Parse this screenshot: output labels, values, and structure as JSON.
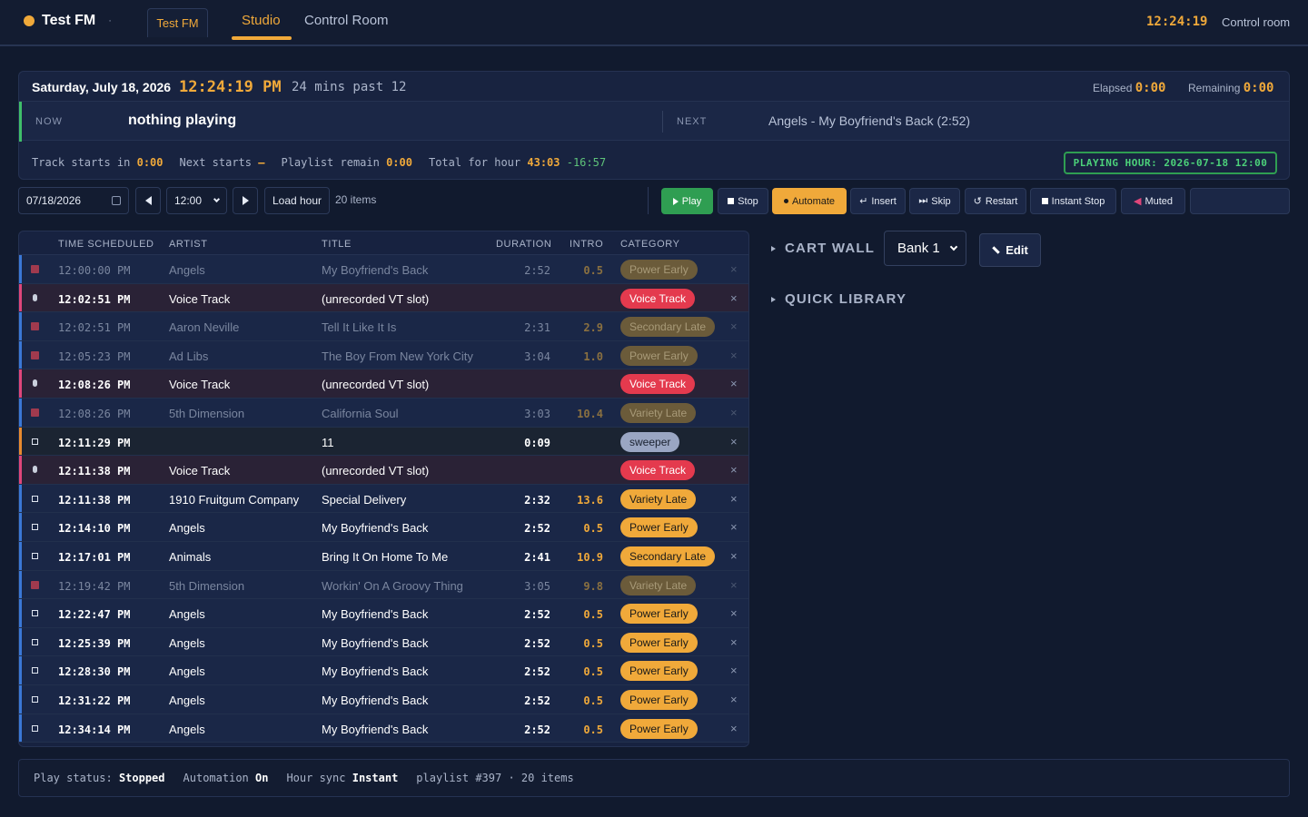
{
  "brand": {
    "name": "Test FM",
    "caret": "·"
  },
  "station_tab": "Test FM",
  "nav": {
    "studio": "Studio",
    "control": "Control Room"
  },
  "top_clock": "12:24:19",
  "top_mode": "Control room",
  "now_panel": {
    "date": "Saturday, July 18, 2026",
    "time": "12:24:19 PM",
    "past": "24 mins past 12",
    "elapsed_label": "Elapsed",
    "elapsed_value": "0:00",
    "remaining_label": "Remaining",
    "remaining_value": "0:00",
    "now_label": "NOW",
    "now_value": "nothing playing",
    "next_label": "NEXT",
    "next_value": "Angels - My Boyfriend's Back (2:52)",
    "track_starts_label": "Track starts in",
    "track_starts_value": "0:00",
    "next_starts_label": "Next starts",
    "next_starts_value": "–",
    "playlist_remain_label": "Playlist remain",
    "playlist_remain_value": "0:00",
    "total_hour_label": "Total for hour",
    "total_hour_value": "43:03",
    "total_hour_delta": "-16:57",
    "hour_badge": "PLAYING HOUR: 2026-07-18 12:00"
  },
  "controls": {
    "date_value": "07/18/2026",
    "hour_value": "12:00",
    "load_label": "Load hour",
    "items_count": "20 items",
    "play": "Play",
    "stop": "Stop",
    "automate": "Automate",
    "insert": "Insert",
    "skip": "Skip",
    "restart": "Restart",
    "instant_stop": "Instant Stop",
    "muted": "Muted"
  },
  "table": {
    "headers": [
      "TIME SCHEDULED",
      "ARTIST",
      "TITLE",
      "DURATION",
      "INTRO",
      "CATEGORY"
    ],
    "rows": [
      {
        "time": "12:00:00 PM",
        "artist": "Angels",
        "title": "My Boyfriend's Back",
        "duration": "2:52",
        "intro": "0.5",
        "category": "Power Early",
        "kind": "played"
      },
      {
        "time": "12:02:51 PM",
        "artist": "Voice Track",
        "title": "(unrecorded VT slot)",
        "duration": "",
        "intro": "",
        "category": "Voice Track",
        "kind": "vt"
      },
      {
        "time": "12:02:51 PM",
        "artist": "Aaron Neville",
        "title": "Tell It Like It Is",
        "duration": "2:31",
        "intro": "2.9",
        "category": "Secondary Late",
        "kind": "played"
      },
      {
        "time": "12:05:23 PM",
        "artist": "Ad Libs",
        "title": "The Boy From New York City",
        "duration": "3:04",
        "intro": "1.0",
        "category": "Power Early",
        "kind": "played"
      },
      {
        "time": "12:08:26 PM",
        "artist": "Voice Track",
        "title": "(unrecorded VT slot)",
        "duration": "",
        "intro": "",
        "category": "Voice Track",
        "kind": "vt"
      },
      {
        "time": "12:08:26 PM",
        "artist": "5th Dimension",
        "title": "California Soul",
        "duration": "3:03",
        "intro": "10.4",
        "category": "Variety Late",
        "kind": "played"
      },
      {
        "time": "12:11:29 PM",
        "artist": "",
        "title": "11",
        "duration": "0:09",
        "intro": "",
        "category": "sweeper",
        "kind": "sweep"
      },
      {
        "time": "12:11:38 PM",
        "artist": "Voice Track",
        "title": "(unrecorded VT slot)",
        "duration": "",
        "intro": "",
        "category": "Voice Track",
        "kind": "vt"
      },
      {
        "time": "12:11:38 PM",
        "artist": "1910 Fruitgum Company",
        "title": "Special Delivery",
        "duration": "2:32",
        "intro": "13.6",
        "category": "Variety Late",
        "kind": "song"
      },
      {
        "time": "12:14:10 PM",
        "artist": "Angels",
        "title": "My Boyfriend's Back",
        "duration": "2:52",
        "intro": "0.5",
        "category": "Power Early",
        "kind": "song"
      },
      {
        "time": "12:17:01 PM",
        "artist": "Animals",
        "title": "Bring It On Home To Me",
        "duration": "2:41",
        "intro": "10.9",
        "category": "Secondary Late",
        "kind": "song"
      },
      {
        "time": "12:19:42 PM",
        "artist": "5th Dimension",
        "title": "Workin' On A Groovy Thing",
        "duration": "3:05",
        "intro": "9.8",
        "category": "Variety Late",
        "kind": "played"
      },
      {
        "time": "12:22:47 PM",
        "artist": "Angels",
        "title": "My Boyfriend's Back",
        "duration": "2:52",
        "intro": "0.5",
        "category": "Power Early",
        "kind": "song"
      },
      {
        "time": "12:25:39 PM",
        "artist": "Angels",
        "title": "My Boyfriend's Back",
        "duration": "2:52",
        "intro": "0.5",
        "category": "Power Early",
        "kind": "song"
      },
      {
        "time": "12:28:30 PM",
        "artist": "Angels",
        "title": "My Boyfriend's Back",
        "duration": "2:52",
        "intro": "0.5",
        "category": "Power Early",
        "kind": "song"
      },
      {
        "time": "12:31:22 PM",
        "artist": "Angels",
        "title": "My Boyfriend's Back",
        "duration": "2:52",
        "intro": "0.5",
        "category": "Power Early",
        "kind": "song"
      },
      {
        "time": "12:34:14 PM",
        "artist": "Angels",
        "title": "My Boyfriend's Back",
        "duration": "2:52",
        "intro": "0.5",
        "category": "Power Early",
        "kind": "song"
      }
    ],
    "remove_glyph": "×"
  },
  "right_panel": {
    "cart_wall": "CART WALL",
    "bank_value": "Bank 1",
    "edit_label": "Edit",
    "quick_library": "QUICK LIBRARY"
  },
  "status_bar": {
    "play_status_label": "Play status:",
    "play_status_value": "Stopped",
    "automation_label": "Automation",
    "automation_value": "On",
    "hour_sync_label": "Hour sync",
    "hour_sync_value": "Instant",
    "playlist_info": "playlist #397 · 20 items"
  },
  "colors": {
    "accent": "#f0a93a",
    "play_green": "#2f9e52",
    "voice_red": "#e43a4e",
    "background": "#111a2e"
  }
}
